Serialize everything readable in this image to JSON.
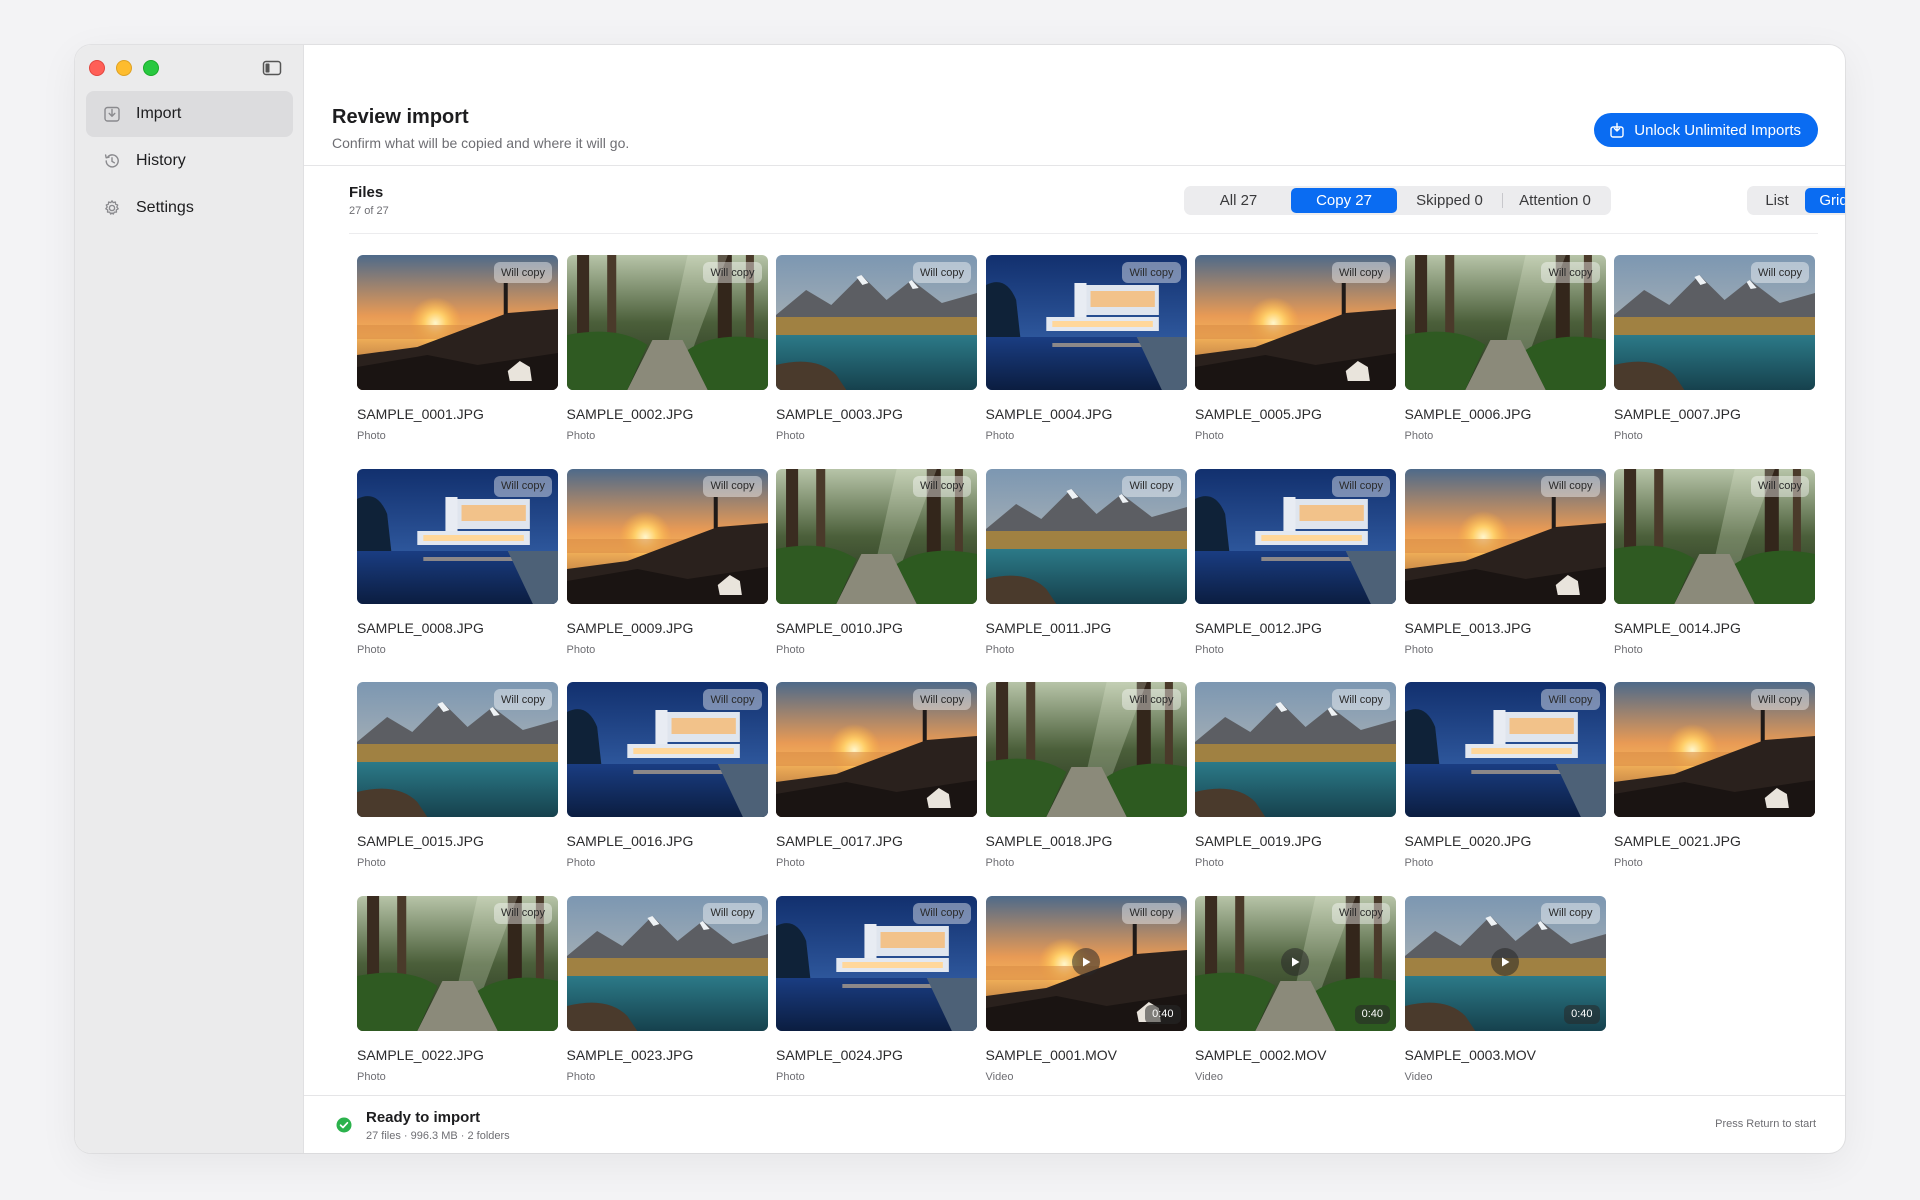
{
  "sidebar": {
    "items": [
      {
        "label": "Import",
        "icon": "import-icon",
        "active": true
      },
      {
        "label": "History",
        "icon": "history-icon",
        "active": false
      },
      {
        "label": "Settings",
        "icon": "gear-icon",
        "active": false
      }
    ]
  },
  "header": {
    "title": "Review import",
    "subtitle": "Confirm what will be copied and where it will go.",
    "unlock_label": "Unlock Unlimited Imports"
  },
  "files": {
    "title": "Files",
    "count": "27 of 27",
    "filters": [
      {
        "label": "All 27",
        "active": false
      },
      {
        "label": "Copy 27",
        "active": true
      },
      {
        "label": "Skipped 0",
        "active": false
      },
      {
        "label": "Attention 0",
        "active": false
      }
    ],
    "views": [
      {
        "label": "List",
        "active": false
      },
      {
        "label": "Grid",
        "active": true
      }
    ],
    "items": [
      {
        "name": "SAMPLE_0001.JPG",
        "type": "Photo",
        "badge": "Will copy",
        "scene": "sunset"
      },
      {
        "name": "SAMPLE_0002.JPG",
        "type": "Photo",
        "badge": "Will copy",
        "scene": "forest"
      },
      {
        "name": "SAMPLE_0003.JPG",
        "type": "Photo",
        "badge": "Will copy",
        "scene": "lake"
      },
      {
        "name": "SAMPLE_0004.JPG",
        "type": "Photo",
        "badge": "Will copy",
        "scene": "house"
      },
      {
        "name": "SAMPLE_0005.JPG",
        "type": "Photo",
        "badge": "Will copy",
        "scene": "sunset"
      },
      {
        "name": "SAMPLE_0006.JPG",
        "type": "Photo",
        "badge": "Will copy",
        "scene": "forest"
      },
      {
        "name": "SAMPLE_0007.JPG",
        "type": "Photo",
        "badge": "Will copy",
        "scene": "lake"
      },
      {
        "name": "SAMPLE_0008.JPG",
        "type": "Photo",
        "badge": "Will copy",
        "scene": "house"
      },
      {
        "name": "SAMPLE_0009.JPG",
        "type": "Photo",
        "badge": "Will copy",
        "scene": "sunset"
      },
      {
        "name": "SAMPLE_0010.JPG",
        "type": "Photo",
        "badge": "Will copy",
        "scene": "forest"
      },
      {
        "name": "SAMPLE_0011.JPG",
        "type": "Photo",
        "badge": "Will copy",
        "scene": "lake"
      },
      {
        "name": "SAMPLE_0012.JPG",
        "type": "Photo",
        "badge": "Will copy",
        "scene": "house"
      },
      {
        "name": "SAMPLE_0013.JPG",
        "type": "Photo",
        "badge": "Will copy",
        "scene": "sunset"
      },
      {
        "name": "SAMPLE_0014.JPG",
        "type": "Photo",
        "badge": "Will copy",
        "scene": "forest"
      },
      {
        "name": "SAMPLE_0015.JPG",
        "type": "Photo",
        "badge": "Will copy",
        "scene": "lake"
      },
      {
        "name": "SAMPLE_0016.JPG",
        "type": "Photo",
        "badge": "Will copy",
        "scene": "house"
      },
      {
        "name": "SAMPLE_0017.JPG",
        "type": "Photo",
        "badge": "Will copy",
        "scene": "sunset"
      },
      {
        "name": "SAMPLE_0018.JPG",
        "type": "Photo",
        "badge": "Will copy",
        "scene": "forest"
      },
      {
        "name": "SAMPLE_0019.JPG",
        "type": "Photo",
        "badge": "Will copy",
        "scene": "lake"
      },
      {
        "name": "SAMPLE_0020.JPG",
        "type": "Photo",
        "badge": "Will copy",
        "scene": "house"
      },
      {
        "name": "SAMPLE_0021.JPG",
        "type": "Photo",
        "badge": "Will copy",
        "scene": "sunset"
      },
      {
        "name": "SAMPLE_0022.JPG",
        "type": "Photo",
        "badge": "Will copy",
        "scene": "forest"
      },
      {
        "name": "SAMPLE_0023.JPG",
        "type": "Photo",
        "badge": "Will copy",
        "scene": "lake"
      },
      {
        "name": "SAMPLE_0024.JPG",
        "type": "Photo",
        "badge": "Will copy",
        "scene": "house"
      },
      {
        "name": "SAMPLE_0001.MOV",
        "type": "Video",
        "badge": "Will copy",
        "scene": "sunset",
        "duration": "0:40"
      },
      {
        "name": "SAMPLE_0002.MOV",
        "type": "Video",
        "badge": "Will copy",
        "scene": "forest",
        "duration": "0:40"
      },
      {
        "name": "SAMPLE_0003.MOV",
        "type": "Video",
        "badge": "Will copy",
        "scene": "lake",
        "duration": "0:40"
      }
    ]
  },
  "footer": {
    "status_title": "Ready to import",
    "status_detail": "27 files · 996.3 MB · 2 folders",
    "hint": "Press Return to start"
  },
  "colors": {
    "accent": "#0a6cf2",
    "success": "#2bb24c"
  }
}
